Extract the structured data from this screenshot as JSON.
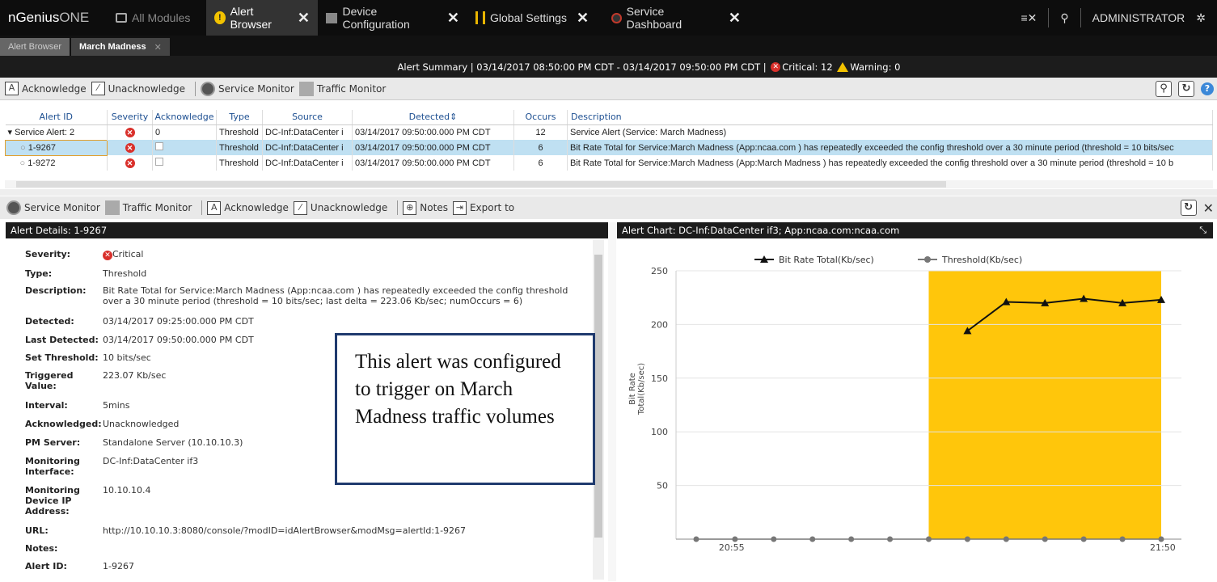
{
  "topbar": {
    "brand": "nGenius",
    "brand_suffix": "ONE",
    "tabs": [
      {
        "label": "All Modules",
        "icon": "layers-icon"
      },
      {
        "label": "Alert Browser",
        "icon": "alert-icon",
        "active": true
      },
      {
        "label": "Device Configuration",
        "icon": "device-icon"
      },
      {
        "label": "Global Settings",
        "icon": "settings-icon"
      },
      {
        "label": "Service Dashboard",
        "icon": "dashboard-icon"
      }
    ],
    "user": "ADMINISTRATOR"
  },
  "subtabs": [
    {
      "label": "Alert Browser"
    },
    {
      "label": "March Madness",
      "active": true
    }
  ],
  "summary": {
    "text": "Alert Summary | 03/14/2017 08:50:00 PM CDT - 03/14/2017 09:50:00 PM CDT |",
    "critical": "Critical: 12",
    "warning": "Warning: 0"
  },
  "toolbar1": {
    "acknowledge": "Acknowledge",
    "unacknowledge": "Unacknowledge",
    "service_monitor": "Service Monitor",
    "traffic_monitor": "Traffic Monitor"
  },
  "grid": {
    "columns": [
      "Alert ID",
      "Severity",
      "Acknowledge",
      "Type",
      "Source",
      "Detected",
      "Occurs",
      "Description"
    ],
    "rows": [
      {
        "id": "Service Alert: 2",
        "ack": "0",
        "type": "Threshold",
        "source": "DC-Inf:DataCenter i",
        "detected": "03/14/2017 09:50:00.000 PM CDT",
        "occurs": "12",
        "desc": "Service Alert (Service: March Madness)"
      },
      {
        "id": "1-9267",
        "ack": "",
        "type": "Threshold",
        "source": "DC-Inf:DataCenter i",
        "detected": "03/14/2017 09:50:00.000 PM CDT",
        "occurs": "6",
        "desc": "Bit Rate Total for Service:March Madness (App:ncaa.com ) has repeatedly exceeded the config threshold over a 30 minute period (threshold = 10 bits/sec"
      },
      {
        "id": "1-9272",
        "ack": "",
        "type": "Threshold",
        "source": "DC-Inf:DataCenter i",
        "detected": "03/14/2017 09:50:00.000 PM CDT",
        "occurs": "6",
        "desc": "Bit Rate Total for Service:March Madness (App:March Madness ) has repeatedly exceeded the config threshold over a 30 minute period (threshold = 10 b"
      }
    ]
  },
  "toolbar2": {
    "service_monitor": "Service Monitor",
    "traffic_monitor": "Traffic Monitor",
    "acknowledge": "Acknowledge",
    "unacknowledge": "Unacknowledge",
    "notes": "Notes",
    "export": "Export to"
  },
  "details": {
    "title": "Alert Details: 1-9267",
    "fields": [
      {
        "label": "Severity:",
        "value": "Critical"
      },
      {
        "label": "Type:",
        "value": "Threshold"
      },
      {
        "label": "Description:",
        "value": "Bit Rate Total for Service:March Madness (App:ncaa.com ) has repeatedly exceeded the config threshold over a 30 minute period (threshold = 10 bits/sec; last delta = 223.06 Kb/sec; numOccurs = 6)"
      },
      {
        "label": "Detected:",
        "value": "03/14/2017 09:25:00.000 PM CDT"
      },
      {
        "label": "Last Detected:",
        "value": "03/14/2017 09:50:00.000 PM CDT"
      },
      {
        "label": "Set Threshold:",
        "value": "10 bits/sec"
      },
      {
        "label": "Triggered Value:",
        "value": "223.07 Kb/sec"
      },
      {
        "label": "Interval:",
        "value": "5mins"
      },
      {
        "label": "Acknowledged:",
        "value": "Unacknowledged"
      },
      {
        "label": "PM Server:",
        "value": "Standalone Server (10.10.10.3)"
      },
      {
        "label": "Monitoring Interface:",
        "value": "DC-Inf:DataCenter if3"
      },
      {
        "label": "Monitoring Device IP Address:",
        "value": "10.10.10.4"
      },
      {
        "label": "URL:",
        "value": "http://10.10.10.3:8080/console/?modID=idAlertBrowser&modMsg=alertId:1-9267"
      },
      {
        "label": "Notes:",
        "value": ""
      },
      {
        "label": "Alert ID:",
        "value": "1-9267"
      }
    ]
  },
  "callout": {
    "text": "This alert was configured to trigger on March Madness traffic volumes"
  },
  "chart_title": "Alert Chart: DC-Inf:DataCenter if3; App:ncaa.com:ncaa.com",
  "chart_data": {
    "type": "line",
    "ylabel": "Bit Rate Total(Kb/sec)",
    "ylim": [
      0,
      250
    ],
    "yticks": [
      50,
      100,
      150,
      200,
      250
    ],
    "xtick_labels": [
      "20:55",
      "21:50"
    ],
    "x": [
      "20:50",
      "20:55",
      "21:00",
      "21:05",
      "21:10",
      "21:15",
      "21:20",
      "21:25",
      "21:30",
      "21:35",
      "21:40",
      "21:45",
      "21:50"
    ],
    "highlight": {
      "from": "21:20",
      "to": "21:50",
      "color": "#ffc60b"
    },
    "series": [
      {
        "name": "Bit Rate Total(Kb/sec)",
        "marker": "triangle",
        "color": "#111111",
        "x": [
          "21:25",
          "21:30",
          "21:35",
          "21:40",
          "21:45",
          "21:50"
        ],
        "values": [
          194,
          221,
          220,
          224,
          220,
          223
        ]
      },
      {
        "name": "Threshold(Kb/sec)",
        "marker": "circle",
        "color": "#777777",
        "x": [
          "20:50",
          "20:55",
          "21:00",
          "21:05",
          "21:10",
          "21:15",
          "21:20",
          "21:25",
          "21:30",
          "21:35",
          "21:40",
          "21:45",
          "21:50"
        ],
        "values": [
          0.01,
          0.01,
          0.01,
          0.01,
          0.01,
          0.01,
          0.01,
          0.01,
          0.01,
          0.01,
          0.01,
          0.01,
          0.01
        ]
      }
    ]
  }
}
